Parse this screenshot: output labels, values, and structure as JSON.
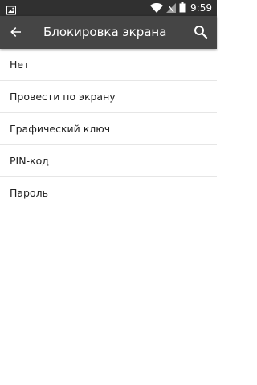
{
  "status_bar": {
    "time": "9:59",
    "icons": [
      "image-notification-icon",
      "wifi-icon",
      "signal-icon",
      "battery-icon"
    ]
  },
  "app_bar": {
    "title": "Блокировка экрана",
    "back_icon": "arrow-back-icon",
    "search_icon": "search-icon"
  },
  "options": [
    {
      "label": "Нет"
    },
    {
      "label": "Провести по экрану"
    },
    {
      "label": "Графический ключ"
    },
    {
      "label": "PIN-код"
    },
    {
      "label": "Пароль"
    }
  ],
  "colors": {
    "status_bar_bg": "#303030",
    "app_bar_bg": "#454545",
    "divider": "#e6e6e6",
    "text": "#212121"
  }
}
